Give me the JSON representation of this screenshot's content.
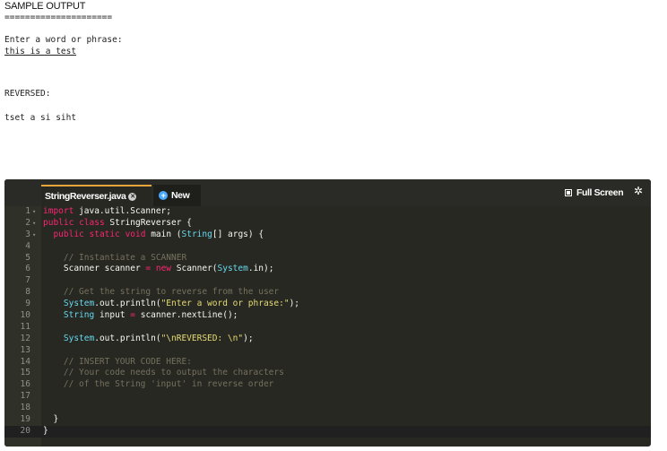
{
  "sample": {
    "title": "SAMPLE OUTPUT",
    "rule": "=====================",
    "prompt": "Enter a word or phrase:",
    "input": "this is a test",
    "reversed_label": "REVERSED:",
    "reversed_value": "tset a si siht"
  },
  "editor": {
    "tabs": [
      {
        "label": "StringReverser.java"
      },
      {
        "label": "New"
      }
    ],
    "fullscreen_label": "Full Screen",
    "current_line": 20,
    "lines": [
      [
        [
          "kw",
          "import"
        ],
        [
          "plain",
          " java.util.Scanner;"
        ]
      ],
      [
        [
          "kw",
          "public"
        ],
        [
          "plain",
          " "
        ],
        [
          "kw",
          "class"
        ],
        [
          "plain",
          " StringReverser {"
        ]
      ],
      [
        [
          "plain",
          "  "
        ],
        [
          "kw",
          "public"
        ],
        [
          "plain",
          " "
        ],
        [
          "kw",
          "static"
        ],
        [
          "plain",
          " "
        ],
        [
          "kw",
          "void"
        ],
        [
          "plain",
          " main ("
        ],
        [
          "ty",
          "String"
        ],
        [
          "plain",
          "[] args) {"
        ]
      ],
      [],
      [
        [
          "plain",
          "    "
        ],
        [
          "cm",
          "// Instantiate a SCANNER"
        ]
      ],
      [
        [
          "plain",
          "    Scanner scanner "
        ],
        [
          "op",
          "="
        ],
        [
          "plain",
          " "
        ],
        [
          "kw",
          "new"
        ],
        [
          "plain",
          " Scanner("
        ],
        [
          "obj",
          "System"
        ],
        [
          "plain",
          ".in);"
        ]
      ],
      [],
      [
        [
          "plain",
          "    "
        ],
        [
          "cm",
          "// Get the string to reverse from the user"
        ]
      ],
      [
        [
          "plain",
          "    "
        ],
        [
          "obj",
          "System"
        ],
        [
          "plain",
          ".out.println("
        ],
        [
          "str",
          "\"Enter a word or phrase:\""
        ],
        [
          "plain",
          ");"
        ]
      ],
      [
        [
          "plain",
          "    "
        ],
        [
          "ty",
          "String"
        ],
        [
          "plain",
          " input "
        ],
        [
          "op",
          "="
        ],
        [
          "plain",
          " scanner.nextLine();"
        ]
      ],
      [],
      [
        [
          "plain",
          "    "
        ],
        [
          "obj",
          "System"
        ],
        [
          "plain",
          ".out.println("
        ],
        [
          "str",
          "\"\\nREVERSED: \\n\""
        ],
        [
          "plain",
          ");"
        ]
      ],
      [],
      [
        [
          "plain",
          "    "
        ],
        [
          "cm",
          "// INSERT YOUR CODE HERE:"
        ]
      ],
      [
        [
          "plain",
          "    "
        ],
        [
          "cm",
          "// Your code needs to output the characters"
        ]
      ],
      [
        [
          "plain",
          "    "
        ],
        [
          "cm",
          "// of the String 'input' in reverse order"
        ]
      ],
      [],
      [],
      [
        [
          "plain",
          "  }"
        ]
      ],
      [
        [
          "plain",
          "}"
        ]
      ]
    ],
    "fold_lines": [
      1,
      2,
      3
    ]
  }
}
